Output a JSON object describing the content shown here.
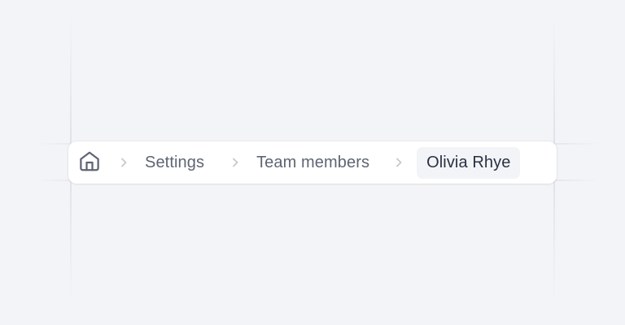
{
  "breadcrumb": {
    "home_icon": "home-icon",
    "separator_icon": "chevron-right-icon",
    "items": [
      {
        "label": "Settings"
      },
      {
        "label": "Team members"
      },
      {
        "label": "Olivia Rhye",
        "current": true
      }
    ]
  },
  "colors": {
    "background": "#f3f4f7",
    "bar": "#ffffff",
    "text": "#5e6573",
    "current_text": "#2a3142",
    "current_bg": "#f2f4f7",
    "separator": "#c4c8cf",
    "icon": "#5e6573"
  }
}
